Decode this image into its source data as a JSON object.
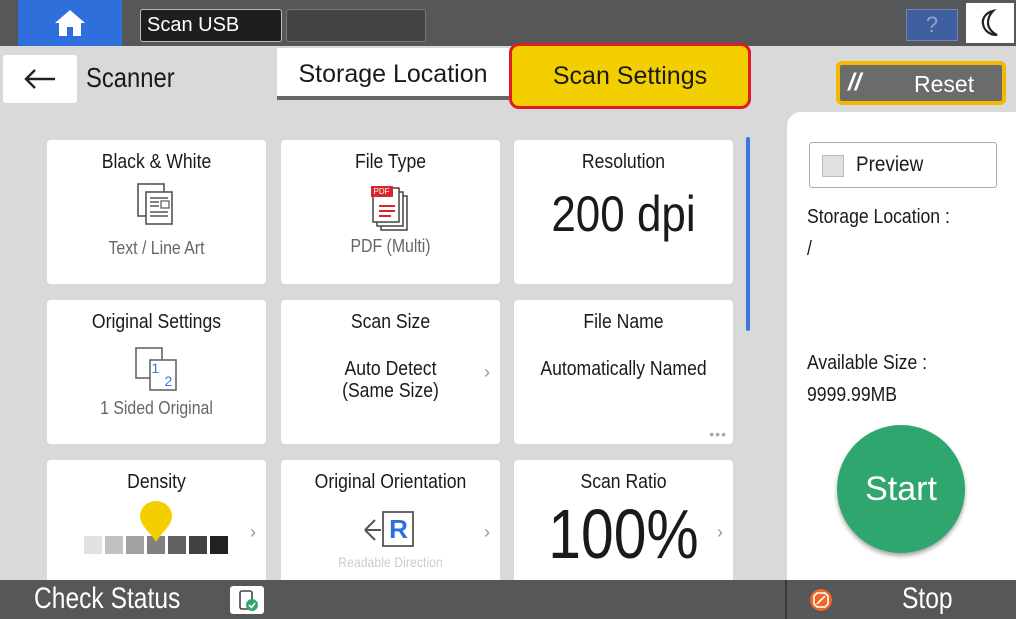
{
  "topbar": {
    "app_label": "Scan USB",
    "help_label": "?"
  },
  "header": {
    "page_title": "Scanner",
    "tabs": [
      {
        "label": "Storage Location",
        "selected": false
      },
      {
        "label": "Scan Settings",
        "selected": true
      }
    ],
    "reset_label": "Reset"
  },
  "tiles": [
    {
      "title": "Black & White",
      "value": "Text / Line Art",
      "icon": "text-line-art-icon"
    },
    {
      "title": "File Type",
      "value": "PDF (Multi)",
      "icon": "pdf-file-icon",
      "icon_text": "PDF"
    },
    {
      "title": "Resolution",
      "value": "200 dpi"
    },
    {
      "title": "Original Settings",
      "value": "1 Sided Original",
      "icon": "one-sided-original-icon",
      "icon_num1": "1",
      "icon_num2": "2"
    },
    {
      "title": "Scan Size",
      "value_line1": "Auto Detect",
      "value_line2": "(Same Size)"
    },
    {
      "title": "File Name",
      "value": "Automatically Named"
    },
    {
      "title": "Density",
      "icon": "density-slider-icon",
      "level": 4,
      "steps": 7
    },
    {
      "title": "Original Orientation",
      "icon": "readable-direction-icon",
      "icon_letter": "R",
      "value": "Readable Direction"
    },
    {
      "title": "Scan Ratio",
      "value": "100%"
    }
  ],
  "right_panel": {
    "preview_label": "Preview",
    "storage_location_label": "Storage Location :",
    "storage_location_value": "/",
    "available_size_label": "Available Size :",
    "available_size_value": "9999.99MB",
    "start_label": "Start"
  },
  "bottombar": {
    "check_status_label": "Check Status",
    "stop_label": "Stop"
  },
  "colors": {
    "accent_yellow": "#f3cf00",
    "highlight_red": "#e11b22",
    "start_green": "#2fa66e",
    "home_blue": "#2f6fdc",
    "stop_orange": "#f26522"
  }
}
